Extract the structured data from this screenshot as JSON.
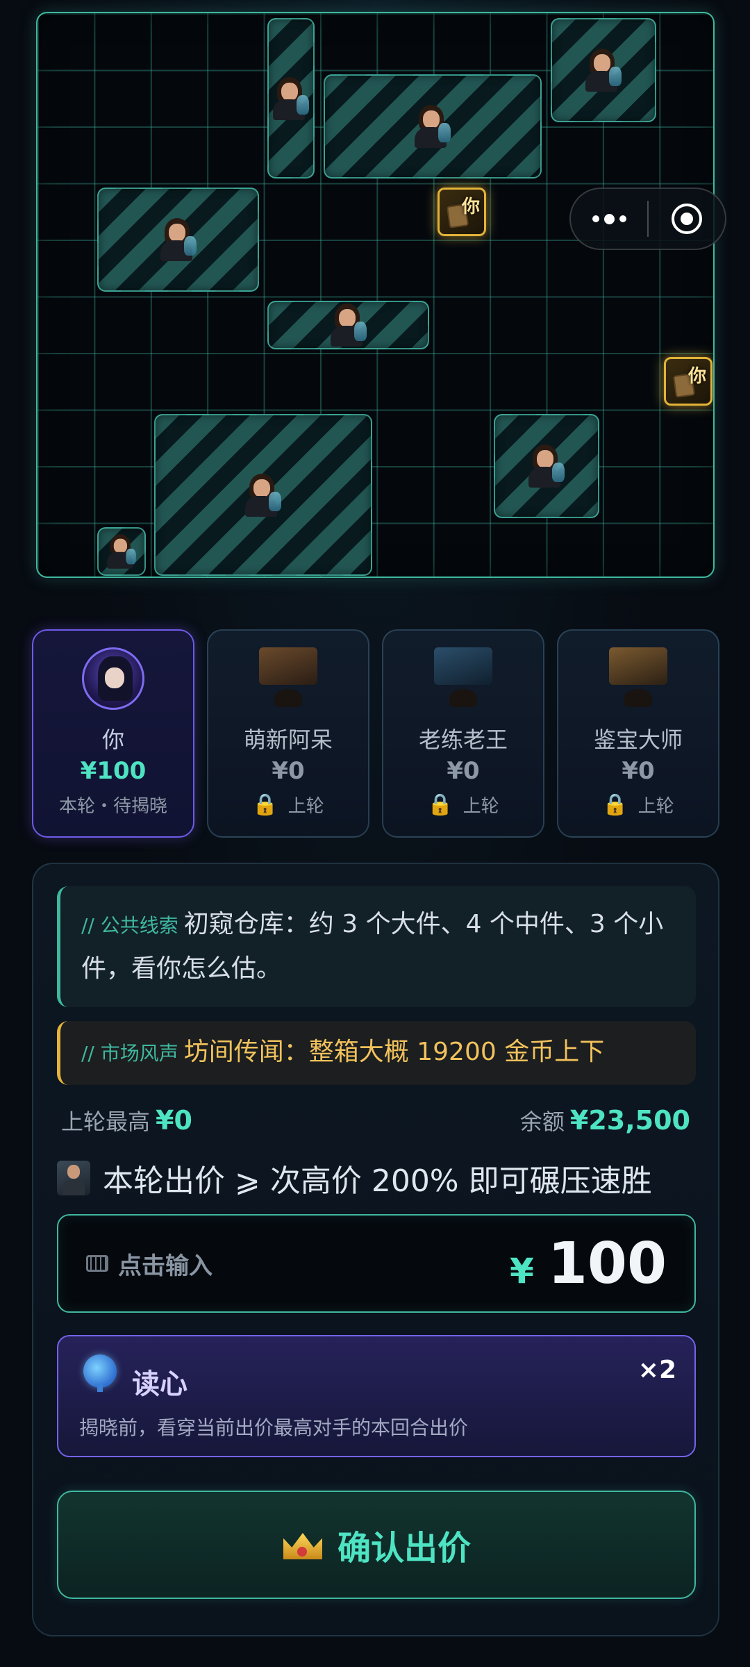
{
  "board": {
    "you_marker_label": "你"
  },
  "players": [
    {
      "name": "你",
      "bid": "¥100",
      "status": "本轮・待揭晓",
      "is_me": true
    },
    {
      "name": "萌新阿呆",
      "bid": "¥0",
      "status": "上轮",
      "is_me": false
    },
    {
      "name": "老练老王",
      "bid": "¥0",
      "status": "上轮",
      "is_me": false
    },
    {
      "name": "鉴宝大师",
      "bid": "¥0",
      "status": "上轮",
      "is_me": false
    }
  ],
  "clues": {
    "public_tag": "// 公共线索",
    "public_text": "初窥仓库：约 3 个大件、4 个中件、3 个小件，看你怎么估。",
    "market_tag": "// 市场风声",
    "market_text": "坊间传闻：整箱大概 19200 金币上下"
  },
  "info": {
    "last_max_label": "上轮最高",
    "last_max_value": "¥0",
    "balance_label": "余额",
    "balance_value": "¥23,500"
  },
  "hint_text": "本轮出价 ⩾ 次高价 200% 即可碾压速胜",
  "bid_input": {
    "placeholder": "点击输入",
    "currency": "¥",
    "value": "100"
  },
  "skill": {
    "name": "读心",
    "count": "×2",
    "description": "揭晓前，看穿当前出价最高对手的本回合出价"
  },
  "confirm_label": "确认出价",
  "colors": {
    "accent": "#4ee3c2",
    "grid": "#3fb8a0",
    "gold": "#e6b33c",
    "purple": "#7563e8"
  }
}
